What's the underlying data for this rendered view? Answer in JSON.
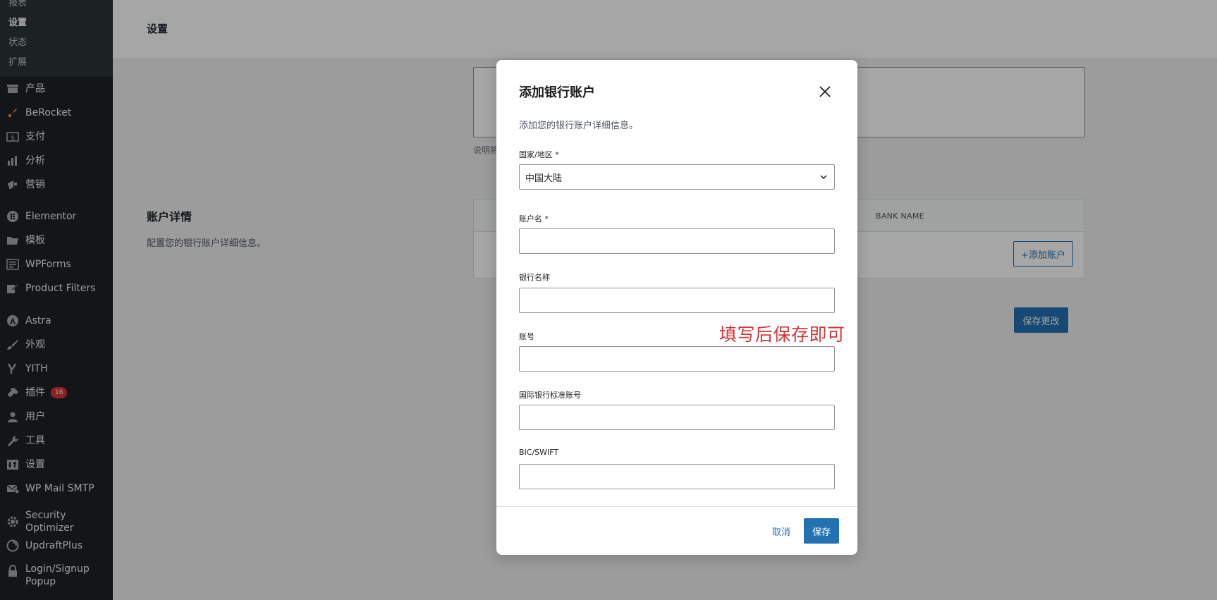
{
  "sidebar": {
    "submenu": [
      {
        "label": "报表",
        "current": false
      },
      {
        "label": "设置",
        "current": true
      },
      {
        "label": "状态",
        "current": false
      },
      {
        "label": "扩展",
        "current": false
      }
    ],
    "items": [
      {
        "label": "产品",
        "icon": "products-icon"
      },
      {
        "label": "BeRocket",
        "icon": "rocket-icon"
      },
      {
        "label": "支付",
        "icon": "payments-icon"
      },
      {
        "label": "分析",
        "icon": "analytics-icon"
      },
      {
        "label": "营销",
        "icon": "megaphone-icon"
      },
      {
        "label": "Elementor",
        "icon": "elementor-icon"
      },
      {
        "label": "模板",
        "icon": "folder-icon"
      },
      {
        "label": "WPForms",
        "icon": "forms-icon"
      },
      {
        "label": "Product Filters",
        "icon": "edit-icon"
      },
      {
        "label": "Astra",
        "icon": "astra-icon"
      },
      {
        "label": "外观",
        "icon": "brush-icon"
      },
      {
        "label": "YITH",
        "icon": "yith-icon"
      },
      {
        "label": "插件",
        "icon": "plugin-icon",
        "badge": "16"
      },
      {
        "label": "用户",
        "icon": "user-icon"
      },
      {
        "label": "工具",
        "icon": "wrench-icon"
      },
      {
        "label": "设置",
        "icon": "settings-icon"
      },
      {
        "label": "WP Mail SMTP",
        "icon": "mail-icon"
      },
      {
        "label": "Security Optimizer",
        "icon": "gear-icon"
      },
      {
        "label": "UpdraftPlus",
        "icon": "updraft-icon"
      },
      {
        "label": "Login/Signup",
        "label2": "Popup",
        "icon": "lock-icon"
      }
    ]
  },
  "page": {
    "title": "设置",
    "help_text": "说明将",
    "section_title": "账户详情",
    "section_desc": "配置您的银行账户详细信息。",
    "table_header_bank": "BANK NAME",
    "add_account_label": "+添加账户",
    "save_changes_label": "保存更改"
  },
  "modal": {
    "title": "添加银行账户",
    "intro": "添加您的银行账户详细信息。",
    "fields": {
      "country": {
        "label": "国家/地区 *",
        "value": "中国大陆"
      },
      "account_name": {
        "label": "账户名 *",
        "value": ""
      },
      "bank_name": {
        "label": "银行名称",
        "value": ""
      },
      "account_number": {
        "label": "账号",
        "value": ""
      },
      "iban": {
        "label": "国际银行标准账号",
        "value": ""
      },
      "bic": {
        "label": "BIC/SWIFT",
        "value": ""
      }
    },
    "cancel_label": "取消",
    "save_label": "保存"
  },
  "annotation": "填写后保存即可",
  "colors": {
    "accent": "#2271b1",
    "sidebar_bg": "#1d2327",
    "badge": "#d63638",
    "annotation": "#d63638"
  }
}
